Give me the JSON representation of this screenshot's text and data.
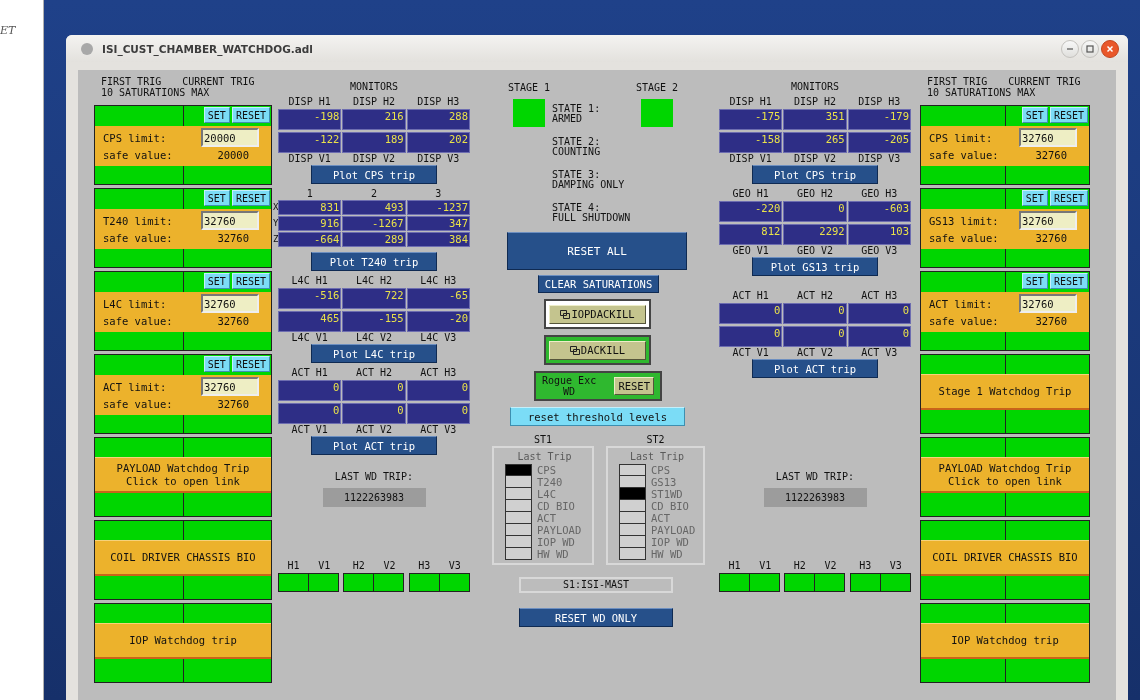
{
  "desktop": {
    "text": "ET"
  },
  "window": {
    "title": "ISI_CUST_CHAMBER_WATCHDOG.adl"
  },
  "panels": [
    {
      "header": [
        "FIRST TRIG",
        "CURRENT TRIG"
      ],
      "subheader": "10 SATURATIONS MAX",
      "limit_cards": [
        {
          "label": "CPS limit:",
          "limit": "20000",
          "safe_label": "safe value:",
          "safe_value": "20000",
          "set": "SET",
          "reset": "RESET",
          "ok": true
        },
        {
          "label": "T240 limit:",
          "limit": "32760",
          "safe_label": "safe value:",
          "safe_value": "32760",
          "set": "SET",
          "reset": "RESET",
          "ok": true
        },
        {
          "label": "L4C limit:",
          "limit": "32760",
          "safe_label": "safe value:",
          "safe_value": "32760",
          "set": "SET",
          "reset": "RESET",
          "ok": true
        },
        {
          "label": "ACT limit:",
          "limit": "32760",
          "safe_label": "safe value:",
          "safe_value": "32760",
          "set": "SET",
          "reset": "RESET",
          "ok": true
        }
      ],
      "link_cards": [
        {
          "lines": [
            "PAYLOAD Watchdog Trip",
            "Click to open link"
          ],
          "ok": true
        },
        {
          "lines": [
            "COIL DRIVER CHASSIS BIO"
          ],
          "ok": true
        },
        {
          "lines": [
            "IOP Watchdog trip"
          ],
          "ok": true
        }
      ]
    },
    {
      "header": [
        "FIRST TRIG",
        "CURRENT TRIG"
      ],
      "subheader": "10 SATURATIONS MAX",
      "limit_cards": [
        {
          "label": "CPS limit:",
          "limit": "32760",
          "safe_label": "safe value:",
          "safe_value": "32760",
          "set": "SET",
          "reset": "RESET",
          "ok": true
        },
        {
          "label": "GS13 limit:",
          "limit": "32760",
          "safe_label": "safe value:",
          "safe_value": "32760",
          "set": "SET",
          "reset": "RESET",
          "ok": true
        },
        {
          "label": "ACT limit:",
          "limit": "32760",
          "safe_label": "safe value:",
          "safe_value": "32760",
          "set": "SET",
          "reset": "RESET",
          "ok": true
        }
      ],
      "link_cards": [
        {
          "lines": [
            "Stage 1 Watchdog Trip"
          ],
          "ok": true
        },
        {
          "lines": [
            "PAYLOAD Watchdog Trip",
            "Click to open link"
          ],
          "ok": true
        },
        {
          "lines": [
            "COIL DRIVER CHASSIS BIO"
          ],
          "ok": true
        },
        {
          "lines": [
            "IOP Watchdog trip"
          ],
          "ok": true
        }
      ]
    }
  ],
  "monitors": [
    {
      "title": "MONITORS",
      "sections": [
        {
          "kind": "pair",
          "columns": [
            "DISP H1",
            "DISP H2",
            "DISP H3"
          ],
          "rows": [
            {
              "values": [
                "-198",
                "216",
                "288"
              ]
            },
            {
              "values": [
                "-122",
                "189",
                "202"
              ]
            }
          ],
          "bottom_labels": [
            "DISP V1",
            "DISP V2",
            "DISP V3"
          ],
          "button": "Plot CPS trip"
        },
        {
          "kind": "xyz",
          "columns": [
            "1",
            "2",
            "3"
          ],
          "rows": [
            {
              "label": "X",
              "values": [
                "831",
                "493",
                "-1237"
              ]
            },
            {
              "label": "Y",
              "values": [
                "916",
                "-1267",
                "347"
              ]
            },
            {
              "label": "Z",
              "values": [
                "-664",
                "289",
                "384"
              ]
            }
          ],
          "button": "Plot T240 trip"
        },
        {
          "kind": "pair",
          "columns": [
            "L4C H1",
            "L4C H2",
            "L4C H3"
          ],
          "rows": [
            {
              "values": [
                "-516",
                "722",
                "-65"
              ]
            },
            {
              "values": [
                "465",
                "-155",
                "-20"
              ]
            }
          ],
          "bottom_labels": [
            "L4C V1",
            "L4C V2",
            "L4C V3"
          ],
          "button": "Plot L4C trip"
        },
        {
          "kind": "pair",
          "columns": [
            "ACT H1",
            "ACT H2",
            "ACT H3"
          ],
          "rows": [
            {
              "values": [
                "0",
                "0",
                "0"
              ]
            },
            {
              "values": [
                "0",
                "0",
                "0"
              ]
            }
          ],
          "bottom_labels": [
            "ACT V1",
            "ACT V2",
            "ACT V3"
          ],
          "button": "Plot ACT trip"
        }
      ],
      "last_wd_trip": {
        "label": "LAST WD TRIP:",
        "value": "1122263983"
      },
      "indicators": [
        {
          "label": "H1",
          "ok": true
        },
        {
          "label": "V1",
          "ok": true
        },
        {
          "label": "H2",
          "ok": true
        },
        {
          "label": "V2",
          "ok": true
        },
        {
          "label": "H3",
          "ok": true
        },
        {
          "label": "V3",
          "ok": true
        }
      ]
    },
    {
      "title": "MONITORS",
      "sections": [
        {
          "kind": "pair",
          "columns": [
            "DISP H1",
            "DISP H2",
            "DISP H3"
          ],
          "rows": [
            {
              "values": [
                "-175",
                "351",
                "-179"
              ]
            },
            {
              "values": [
                "-158",
                "265",
                "-205"
              ]
            }
          ],
          "bottom_labels": [
            "DISP V1",
            "DISP V2",
            "DISP V3"
          ],
          "button": "Plot CPS trip"
        },
        {
          "kind": "pair",
          "columns": [
            "GEO H1",
            "GEO H2",
            "GEO H3"
          ],
          "rows": [
            {
              "values": [
                "-220",
                "0",
                "-603"
              ]
            },
            {
              "values": [
                "812",
                "2292",
                "103"
              ]
            }
          ],
          "bottom_labels": [
            "GEO V1",
            "GEO V2",
            "GEO V3"
          ],
          "button": "Plot GS13 trip"
        },
        {
          "kind": "pair",
          "columns": [
            "ACT H1",
            "ACT H2",
            "ACT H3"
          ],
          "rows": [
            {
              "values": [
                "0",
                "0",
                "0"
              ]
            },
            {
              "values": [
                "0",
                "0",
                "0"
              ]
            }
          ],
          "bottom_labels": [
            "ACT V1",
            "ACT V2",
            "ACT V3"
          ],
          "button": "Plot ACT trip"
        }
      ],
      "last_wd_trip": {
        "label": "LAST WD TRIP:",
        "value": "1122263983"
      },
      "indicators": [
        {
          "label": "H1",
          "ok": true
        },
        {
          "label": "V1",
          "ok": true
        },
        {
          "label": "H2",
          "ok": true
        },
        {
          "label": "V2",
          "ok": true
        },
        {
          "label": "H3",
          "ok": true
        },
        {
          "label": "V3",
          "ok": true
        }
      ]
    }
  ],
  "center": {
    "stages": [
      {
        "label": "STAGE 1",
        "ok": true
      },
      {
        "label": "STAGE 2",
        "ok": true
      }
    ],
    "states": [
      {
        "title": "STATE 1:",
        "name": "ARMED"
      },
      {
        "title": "STATE 2:",
        "name": "COUNTING"
      },
      {
        "title": "STATE 3:",
        "name": "DAMPING ONLY"
      },
      {
        "title": "STATE 4:",
        "name": "FULL SHUTDOWN"
      }
    ],
    "reset_all": "RESET ALL",
    "clear_saturations": "CLEAR SATURATIONS",
    "kill_buttons": [
      {
        "label": "IOPDACKILL",
        "active": false
      },
      {
        "label": "DACKILL",
        "active": true
      }
    ],
    "rogue": {
      "lines": [
        "Rogue Exc",
        "WD"
      ],
      "reset": "RESET"
    },
    "reset_threshold": "reset threshold levels",
    "last_trip": [
      {
        "stage": "ST1",
        "title": "Last Trip",
        "items": [
          {
            "label": "CPS",
            "tripped": true
          },
          {
            "label": "T240",
            "tripped": false
          },
          {
            "label": "L4C",
            "tripped": false
          },
          {
            "label": "CD BIO",
            "tripped": false
          },
          {
            "label": "ACT",
            "tripped": false
          },
          {
            "label": "PAYLOAD",
            "tripped": false
          },
          {
            "label": "IOP WD",
            "tripped": false
          },
          {
            "label": "HW WD",
            "tripped": false
          }
        ]
      },
      {
        "stage": "ST2",
        "title": "Last Trip",
        "items": [
          {
            "label": "CPS",
            "tripped": false
          },
          {
            "label": "GS13",
            "tripped": false
          },
          {
            "label": "ST1WD",
            "tripped": true
          },
          {
            "label": "CD BIO",
            "tripped": false
          },
          {
            "label": "ACT",
            "tripped": false
          },
          {
            "label": "PAYLOAD",
            "tripped": false
          },
          {
            "label": "IOP WD",
            "tripped": false
          },
          {
            "label": "HW WD",
            "tripped": false
          }
        ]
      }
    ],
    "channel": "S1:ISI-MAST",
    "reset_wd_only": "RESET WD ONLY"
  }
}
